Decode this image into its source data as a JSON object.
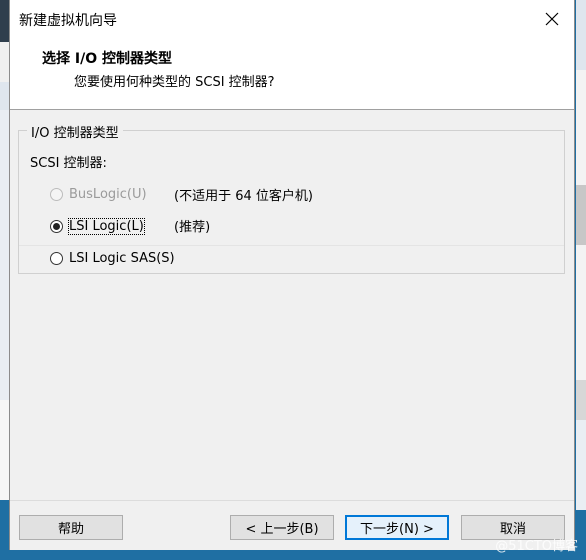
{
  "window": {
    "title": "新建虚拟机向导"
  },
  "header": {
    "title": "选择 I/O 控制器类型",
    "subtitle": "您要使用何种类型的 SCSI 控制器?"
  },
  "group": {
    "legend": "I/O 控制器类型",
    "scsi_label": "SCSI 控制器:",
    "options": [
      {
        "label": "BusLogic(U)",
        "note": "(不适用于 64 位客户机)",
        "selected": false,
        "disabled": true
      },
      {
        "label": "LSI Logic(L)",
        "note": "(推荐)",
        "selected": true,
        "disabled": false
      },
      {
        "label": "LSI Logic SAS(S)",
        "note": "",
        "selected": false,
        "disabled": false
      }
    ]
  },
  "buttons": {
    "help": "帮助",
    "back": "< 上一步(B)",
    "next": "下一步(N) >",
    "cancel": "取消"
  },
  "watermark": "@51CTO博客",
  "colors": {
    "accent": "#0078d7",
    "desktop": "#1f6fa3"
  }
}
